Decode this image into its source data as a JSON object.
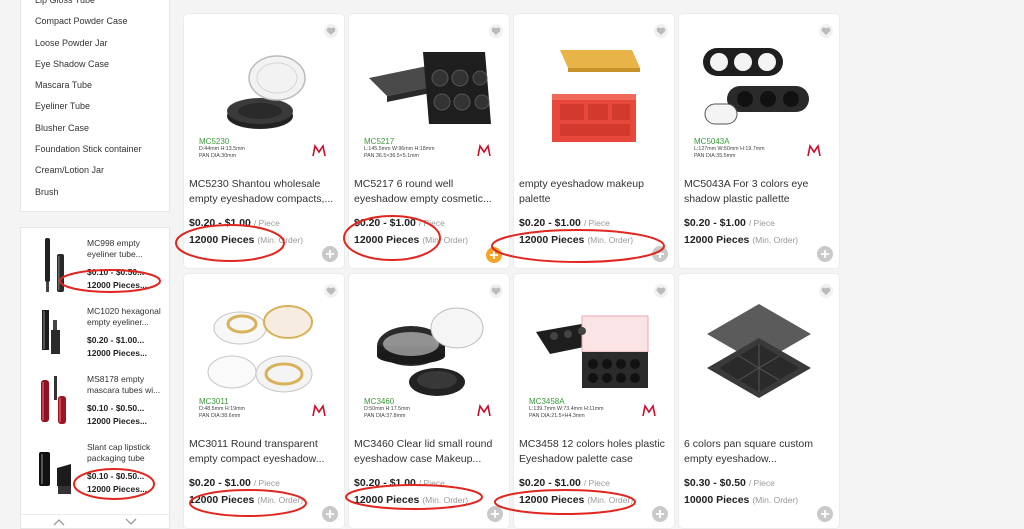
{
  "categories": [
    "Lip Gloss Tube",
    "Compact Powder Case",
    "Loose Powder Jar",
    "Eye Shadow Case",
    "Mascara Tube",
    "Eyeliner Tube",
    "Blusher Case",
    "Foundation Stick container",
    "Cream/Lotion Jar",
    "Brush"
  ],
  "related": [
    {
      "title": "MC998 empty eyeliner tube...",
      "price": "$0.10 - $0.50...",
      "moq": "12000 Pieces..."
    },
    {
      "title": "MC1020 hexagonal empty eyeliner...",
      "price": "$0.20 - $1.00...",
      "moq": "12000 Pieces..."
    },
    {
      "title": "MS8178 empty mascara tubes wi...",
      "price": "$0.10 - $0.50...",
      "moq": "12000 Pieces..."
    },
    {
      "title": "Slant cap lipstick packaging tube",
      "price": "$0.10 - $0.50...",
      "moq": "12000 Pieces..."
    }
  ],
  "price_unit": "/ Piece",
  "moq_unit": "(Min. Order)",
  "products": [
    {
      "title": "MC5230 Shantou wholesale empty eyeshadow compacts,...",
      "price": "$0.20 - $1.00",
      "moq": "12000 Pieces",
      "model": "MC5230",
      "spec": [
        "D:44mm  H:13.5mm",
        "PAN DIA:30mm"
      ],
      "plus_color": "grey"
    },
    {
      "title": "MC5217 6 round well eyeshadow empty cosmetic...",
      "price": "$0.20 - $1.00",
      "moq": "12000 Pieces",
      "model": "MC5217",
      "spec": [
        "L:145.5mm  W:96mm  H:18mm",
        "PAN 36.5×36.5×5.1mm"
      ],
      "plus_color": "orange"
    },
    {
      "title": "empty eyeshadow makeup palette",
      "price": "$0.20 - $1.00",
      "moq": "12000 Pieces",
      "model": "",
      "spec": [],
      "plus_color": "grey"
    },
    {
      "title": "MC5043A For 3 colors eye shadow plastic pallette",
      "price": "$0.20 - $1.00",
      "moq": "12000 Pieces",
      "model": "MC5043A",
      "spec": [
        "L:127mm  W:50mm  H:19.7mm",
        "PAN DIA:35.5mm"
      ],
      "plus_color": "grey"
    },
    {
      "title": "MC3011 Round transparent empty compact eyeshadow...",
      "price": "$0.20 - $1.00",
      "moq": "12000 Pieces",
      "model": "MC3011",
      "spec": [
        "D:48.5mm  H:19mm",
        "PAN DIA:38.6mm"
      ],
      "plus_color": "grey"
    },
    {
      "title": "MC3460 Clear lid small round eyeshadow case Makeup...",
      "price": "$0.20 - $1.00",
      "moq": "12000 Pieces",
      "model": "MC3460",
      "spec": [
        "D:50mm  H:17.5mm",
        "PAN DIA:37.8mm"
      ],
      "plus_color": "grey"
    },
    {
      "title": "MC3458 12 colors holes plastic Eyeshadow palette case",
      "price": "$0.20 - $1.00",
      "moq": "12000 Pieces",
      "model": "MC3458A",
      "spec": [
        "L:139.7mm  W:73.4mm  H:11mm",
        "PAN DIA:21.5×H4.3mm"
      ],
      "plus_color": "grey"
    },
    {
      "title": "6 colors pan square custom empty eyeshadow...",
      "price": "$0.30 - $0.50",
      "moq": "10000 Pieces",
      "model": "",
      "spec": [],
      "plus_color": "grey"
    }
  ],
  "colors": {
    "annotation_red": "#e0261f",
    "model_green": "#3a9a3a",
    "logo_red": "#c8102e",
    "orange_plus": "#f4a52a"
  },
  "icons": {
    "heart": "heart-icon",
    "plus": "plus-icon",
    "arrow_up": "chevron-up-icon",
    "arrow_down": "chevron-down-icon"
  }
}
